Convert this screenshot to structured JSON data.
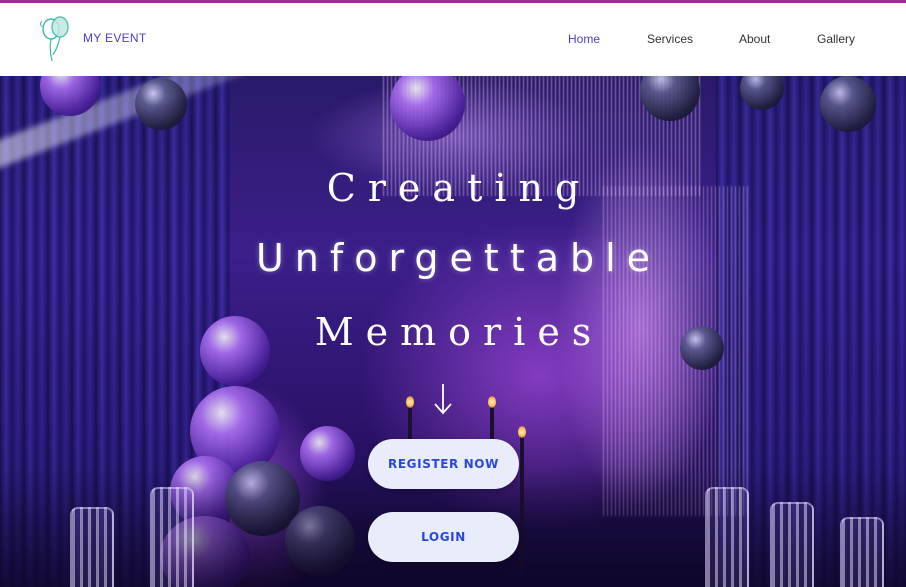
{
  "header": {
    "brand": "MY EVENT",
    "logo_icon": "balloons-icon",
    "nav": [
      {
        "label": "Home",
        "active": true
      },
      {
        "label": "Services",
        "active": false
      },
      {
        "label": "About",
        "active": false
      },
      {
        "label": "Gallery",
        "active": false
      }
    ]
  },
  "hero": {
    "line1": "Creating",
    "line2": "Unforgettable",
    "line3": "Memories",
    "scroll_icon": "arrow-down-icon",
    "register_label": "REGISTER NOW",
    "login_label": "LOGIN"
  },
  "colors": {
    "accent": "#4a3fd0",
    "top_border": "#a12a9a",
    "button_bg": "#e8ecfb",
    "button_text": "#2a48d8"
  }
}
